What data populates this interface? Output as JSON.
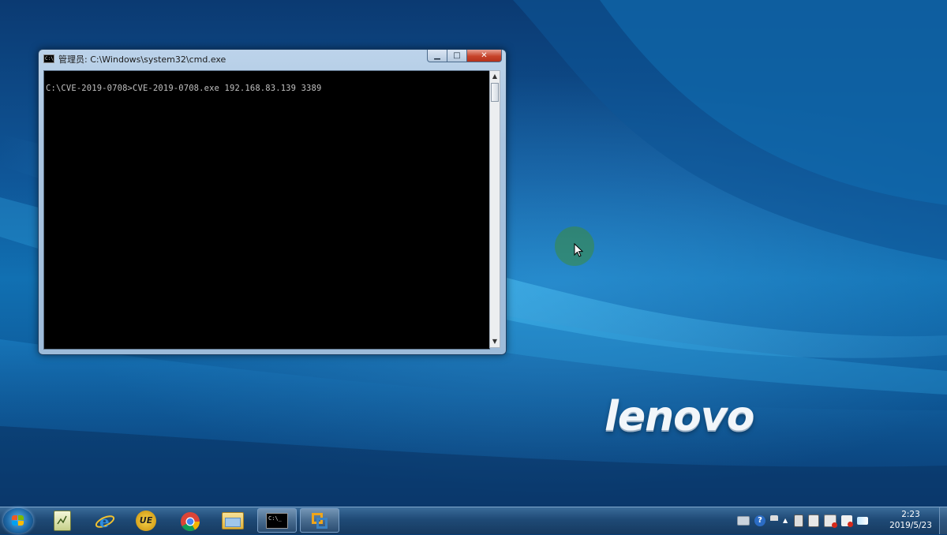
{
  "window": {
    "title": "管理员: C:\\Windows\\system32\\cmd.exe",
    "icon_text": "C:\\",
    "minimize_glyph": "▁",
    "maximize_glyph": "□",
    "close_glyph": "✕",
    "console_line": "C:\\CVE-2019-0708>CVE-2019-0708.exe 192.168.83.139 3389"
  },
  "desktop": {
    "brand_text": "lenovo"
  },
  "taskbar": {
    "pinned": [
      {
        "name": "notepad-icon"
      },
      {
        "name": "internet-explorer-icon"
      },
      {
        "name": "ultraedit-icon",
        "label": "UE"
      },
      {
        "name": "chrome-icon"
      },
      {
        "name": "file-explorer-icon"
      },
      {
        "name": "cmd-icon",
        "label": "C:\\_"
      },
      {
        "name": "vmware-icon"
      }
    ],
    "tray_icons": [
      "keyboard-icon",
      "help-icon",
      "flag-icon",
      "chevron-up-icon",
      "video-icon",
      "pc-icon",
      "network-warning-icon",
      "volume-muted-icon",
      "signal-icon"
    ],
    "clock_time": "2:23",
    "clock_date": "2019/5/23"
  },
  "colors": {
    "console_bg": "#000000",
    "console_text": "#c0c0c0",
    "taskbar": "#1f4a76",
    "close_button": "#c7432b"
  }
}
